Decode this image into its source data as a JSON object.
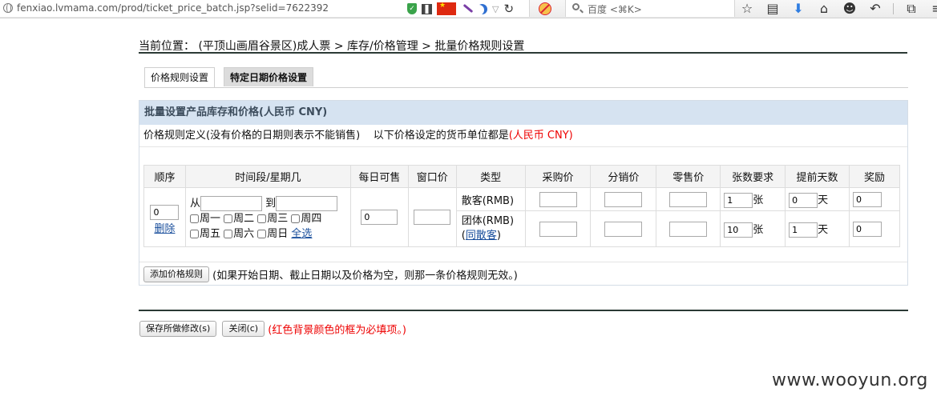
{
  "browser": {
    "url": "fenxiao.lvmama.com/prod/ticket_price_batch.jsp?selid=7622392",
    "search_placeholder": "百度 <⌘K>"
  },
  "breadcrumb": "当前位置： (平顶山画眉谷景区)成人票 > 库存/价格管理 > 批量价格规则设置",
  "tabs": [
    {
      "label": "价格规则设置"
    },
    {
      "label": "特定日期价格设置"
    }
  ],
  "panel": {
    "title": "批量设置产品库存和价格(人民币 CNY)",
    "definition": "价格规则定义(没有价格的日期则表示不能销售)",
    "currency_prefix": "以下价格设定的货币单位都是",
    "currency": "(人民币 CNY)"
  },
  "table": {
    "headers": [
      "顺序",
      "时间段/星期几",
      "每日可售",
      "窗口价",
      "类型",
      "采购价",
      "分销价",
      "零售价",
      "张数要求",
      "提前天数",
      "奖励"
    ],
    "order_value": "0",
    "delete_label": "删除",
    "from_label": "从",
    "to_label": "到",
    "weekdays_row1": [
      "周一",
      "周二",
      "周三",
      "周四"
    ],
    "weekdays_row2": [
      "周五",
      "周六",
      "周日"
    ],
    "select_all": "全选",
    "daily_available": "0",
    "window_price": "",
    "rows": [
      {
        "type": "散客(RMB)",
        "count": "1",
        "count_unit": "张",
        "days": "0",
        "days_unit": "天",
        "reward": "0"
      },
      {
        "type": "团体(RMB)",
        "link": "同散客",
        "count": "10",
        "count_unit": "张",
        "days": "1",
        "days_unit": "天",
        "reward": "0"
      }
    ]
  },
  "add_rule": {
    "button": "添加价格规则",
    "note": "(如果开始日期、截止日期以及价格为空，则那一条价格规则无效。)"
  },
  "footer": {
    "save_button": "保存所做修改(s)",
    "close_button": "关闭(c)",
    "note": "(红色背景颜色的框为必填项。)"
  },
  "watermark": "www.wooyun.org",
  "colors": {
    "panel_header_bg": "#d6e3f1",
    "required_text": "#e00000",
    "link": "#1a4f9c"
  }
}
